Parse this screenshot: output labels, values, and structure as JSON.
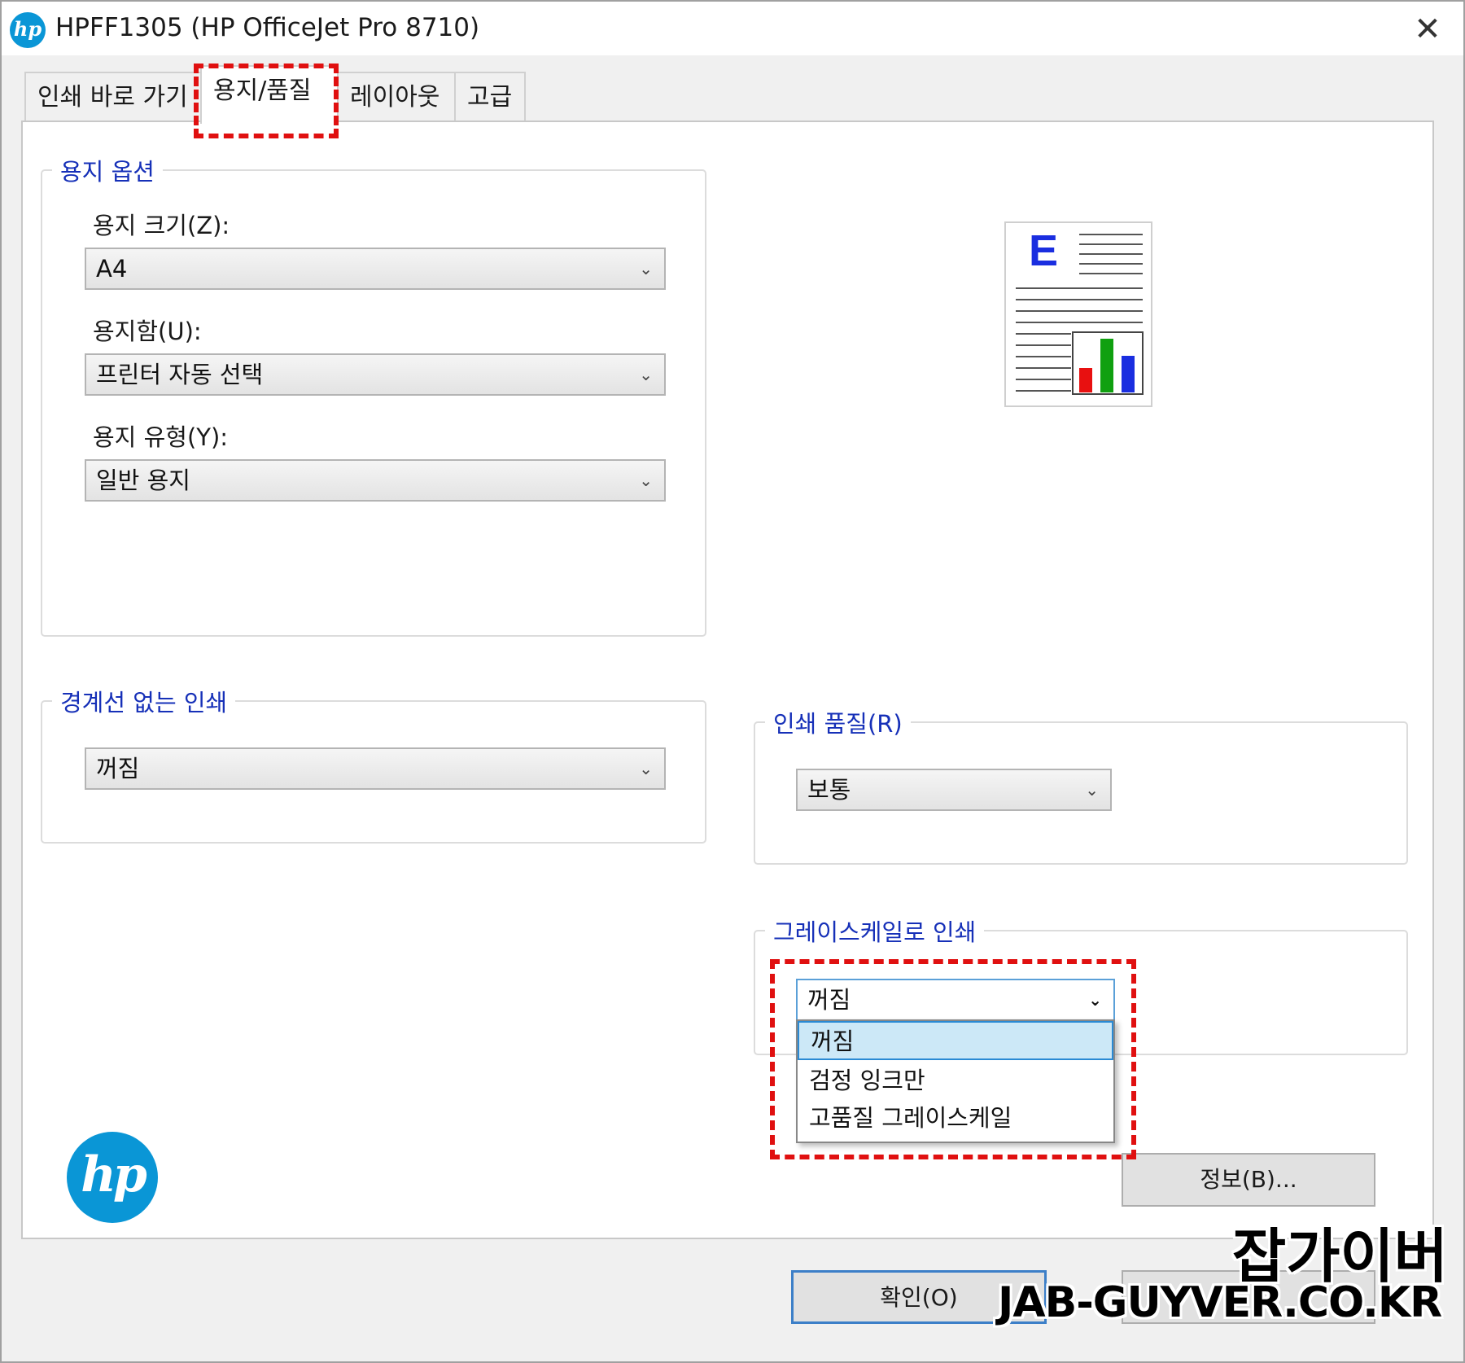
{
  "window": {
    "title": "HPFF1305 (HP OfficeJet Pro 8710)",
    "logo_text": "hp",
    "close_glyph": "✕"
  },
  "tabs": [
    {
      "label": "인쇄 바로 가기"
    },
    {
      "label": "용지/품질"
    },
    {
      "label": "레이아웃"
    },
    {
      "label": "고급"
    }
  ],
  "paper_options": {
    "group_label": "용지 옵션",
    "size_label": "용지 크기(Z):",
    "size_value": "A4",
    "tray_label": "용지함(U):",
    "tray_value": "프린터 자동 선택",
    "type_label": "용지 유형(Y):",
    "type_value": "일반 용지"
  },
  "borderless": {
    "group_label": "경계선 없는 인쇄",
    "value": "꺼짐"
  },
  "print_quality": {
    "group_label": "인쇄 품질(R)",
    "value": "보통"
  },
  "grayscale": {
    "group_label": "그레이스케일로 인쇄",
    "value": "꺼짐",
    "options": [
      "꺼짐",
      "검정 잉크만",
      "고품질 그레이스케일"
    ]
  },
  "preview": {
    "letter": "E",
    "bars": [
      {
        "color": "#e81010",
        "level": 0.45
      },
      {
        "color": "#10a010",
        "level": 1.0
      },
      {
        "color": "#1a2ee0",
        "level": 0.68
      }
    ]
  },
  "brand_logo_text": "hp",
  "buttons": {
    "about": "정보(B)...",
    "ok": "확인(O)"
  },
  "watermark": {
    "line1": "잡가이버",
    "line2": "JAB-GUYVER.CO.KR"
  },
  "colors": {
    "group_label": "#1630b8",
    "highlight": "#e01010",
    "hp_blue": "#0a96d6",
    "selection": "#cce8f7"
  }
}
